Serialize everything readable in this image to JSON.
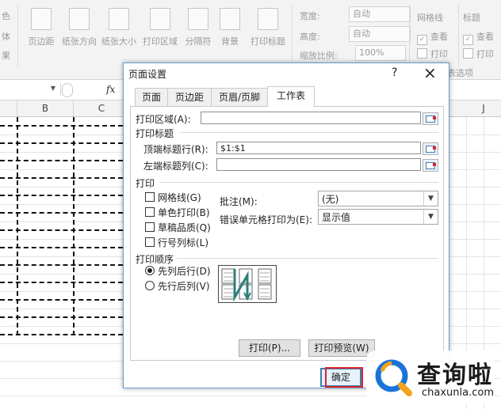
{
  "ribbon": {
    "partial_left": [
      "色",
      "体",
      "果"
    ],
    "buttons": [
      "页边距",
      "纸张方向",
      "纸张大小",
      "打印区域",
      "分隔符",
      "背景",
      "打印标题"
    ],
    "width_label": "宽度:",
    "width_value": "自动",
    "height_label": "高度:",
    "height_value": "自动",
    "scale_label": "缩放比例:",
    "scale_value": "100%",
    "gridlines_group": "网格线",
    "headings_group": "标题",
    "view_label": "查看",
    "print_label": "打印",
    "sheet_options_partial": "表选项"
  },
  "formula_bar": {
    "fx": "fx"
  },
  "columns": [
    "B",
    "C",
    "J"
  ],
  "dialog": {
    "title": "页面设置",
    "help": "?",
    "close": "×",
    "tabs": [
      "页面",
      "页边距",
      "页眉/页脚",
      "工作表"
    ],
    "print_area_label": "打印区域(A):",
    "print_area_value": "",
    "print_titles_label": "打印标题",
    "rows_repeat_label": "顶端标题行(R):",
    "rows_repeat_value": "$1:$1",
    "cols_repeat_label": "左端标题列(C):",
    "cols_repeat_value": "",
    "print_section": "打印",
    "gridlines": "网格线(G)",
    "mono": "单色打印(B)",
    "draft": "草稿品质(Q)",
    "rowcol_headings": "行号列标(L)",
    "comments_label": "批注(M):",
    "comments_value": "(无)",
    "errors_label": "错误单元格打印为(E):",
    "errors_value": "显示值",
    "order_section": "打印顺序",
    "down_then_over": "先列后行(D)",
    "over_then_down": "先行后列(V)",
    "print_btn": "打印(P)...",
    "preview_btn": "打印预览(W)",
    "ok_btn": "确定"
  },
  "watermark": {
    "brand": "查询啦",
    "url": "chaxunla.com"
  }
}
